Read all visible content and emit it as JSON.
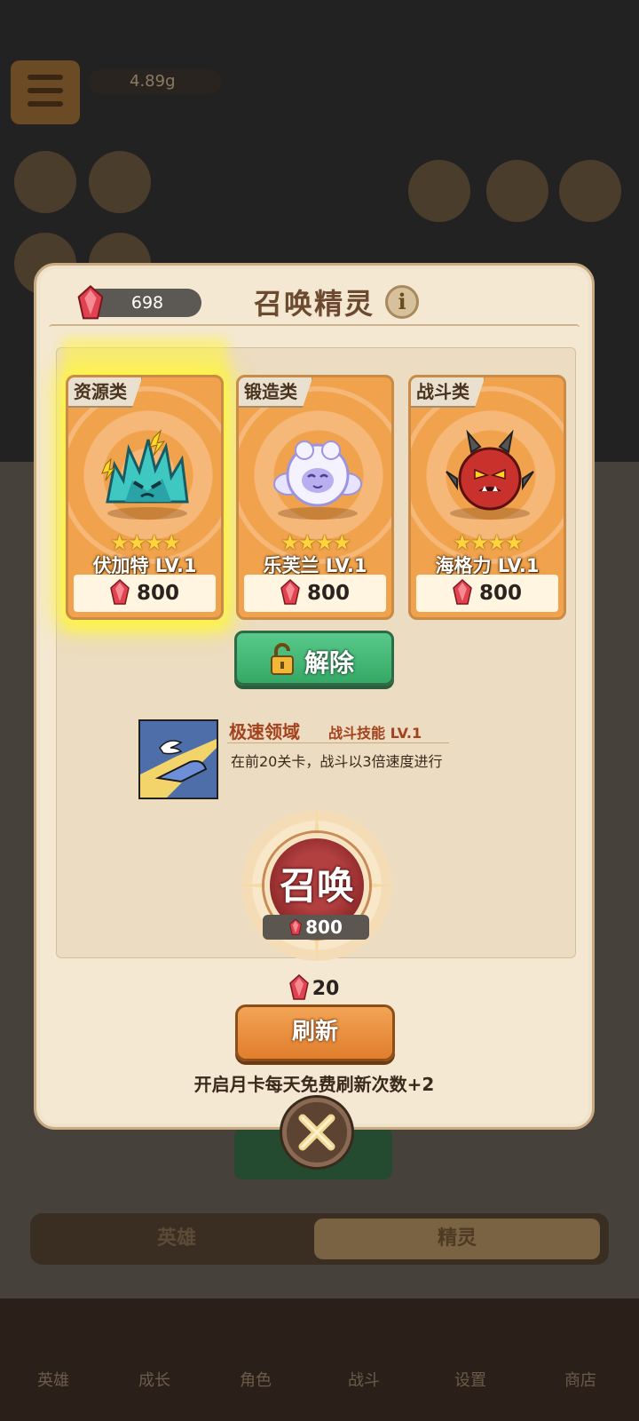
{
  "background": {
    "power_value": "4.89g",
    "tabs": [
      "英雄",
      "精灵"
    ],
    "bottom_nav": [
      "英雄",
      "成长",
      "角色",
      "战斗",
      "设置",
      "商店"
    ]
  },
  "dialog": {
    "gem_count": "698",
    "title": "召唤精灵",
    "info_label": "i",
    "cards": [
      {
        "category": "资源类",
        "name": "伏加特  LV.1",
        "stars": "★★★★",
        "price": "800"
      },
      {
        "category": "锻造类",
        "name": "乐芙兰  LV.1",
        "stars": "★★★★",
        "price": "800"
      },
      {
        "category": "战斗类",
        "name": "海格力  LV.1",
        "stars": "★★★★",
        "price": "800"
      }
    ],
    "unlock_label": "解除",
    "skill": {
      "name": "极速领域",
      "type": "战斗技能 LV.1",
      "description": "在前20关卡，战斗以3倍速度进行"
    },
    "summon": {
      "label": "召唤",
      "price": "800"
    },
    "refresh": {
      "cost": "20",
      "label": "刷新"
    },
    "monthly_note": "开启月卡每天免费刷新次数+2"
  },
  "colors": {
    "gem": "#e0424f",
    "accent_orange": "#e8893a",
    "unlock_green": "#45b574"
  }
}
